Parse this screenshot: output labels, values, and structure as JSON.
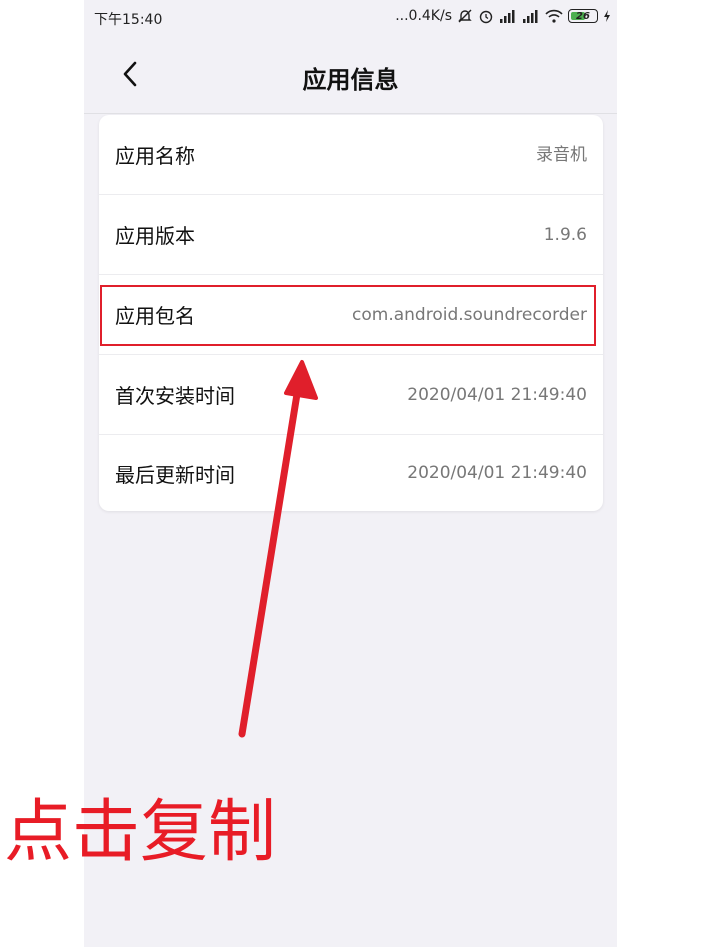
{
  "status_bar": {
    "time": "下午15:40",
    "network_speed": "...0.4K/s",
    "battery_level": "26",
    "battery_color": "#4caf50"
  },
  "nav": {
    "back_icon": "chevron-left",
    "title": "应用信息"
  },
  "rows": [
    {
      "label": "应用名称",
      "value": "录音机"
    },
    {
      "label": "应用版本",
      "value": "1.9.6"
    },
    {
      "label": "应用包名",
      "value": "com.android.soundrecorder"
    },
    {
      "label": "首次安装时间",
      "value": "2020/04/01 21:49:40"
    },
    {
      "label": "最后更新时间",
      "value": "2020/04/01 21:49:40"
    }
  ],
  "annotation": {
    "text": "点击复制",
    "color": "#e81c26"
  }
}
